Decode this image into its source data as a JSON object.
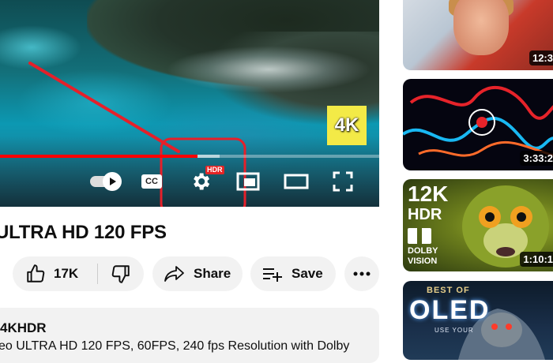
{
  "player": {
    "badge_4k": "4K",
    "hdr_badge": "HDR",
    "cc_label": "CC",
    "progress_fraction": 0.52,
    "buffer_fraction": 0.06,
    "colors": {
      "progress": "#ff0000",
      "annotation": "#e5202a",
      "badge_4k_bg": "#f3ea47"
    },
    "icons": {
      "autoplay": "autoplay-toggle-icon",
      "captions": "closed-captions-icon",
      "settings": "gear-icon",
      "miniplayer": "miniplayer-icon",
      "theater": "theater-mode-icon",
      "fullscreen": "fullscreen-icon"
    }
  },
  "video": {
    "title": "ULTRA HD 120 FPS",
    "likes": "17K",
    "share_label": "Share",
    "save_label": "Save"
  },
  "description": {
    "channel": "4KHDR",
    "text": "eo ULTRA HD 120 FPS, 60FPS, 240 fps Resolution with Dolby"
  },
  "sidebar": {
    "items": [
      {
        "duration": "12:3"
      },
      {
        "duration": "3:33:2"
      },
      {
        "duration": "1:10:1",
        "overlay": {
          "res": "12K",
          "hdr": "HDR",
          "dolby": "DOLBY",
          "vision": "VISION"
        }
      },
      {
        "overlay": {
          "best_of": "BEST OF",
          "oled": "OLED",
          "sub": "USE YOUR"
        }
      }
    ]
  }
}
